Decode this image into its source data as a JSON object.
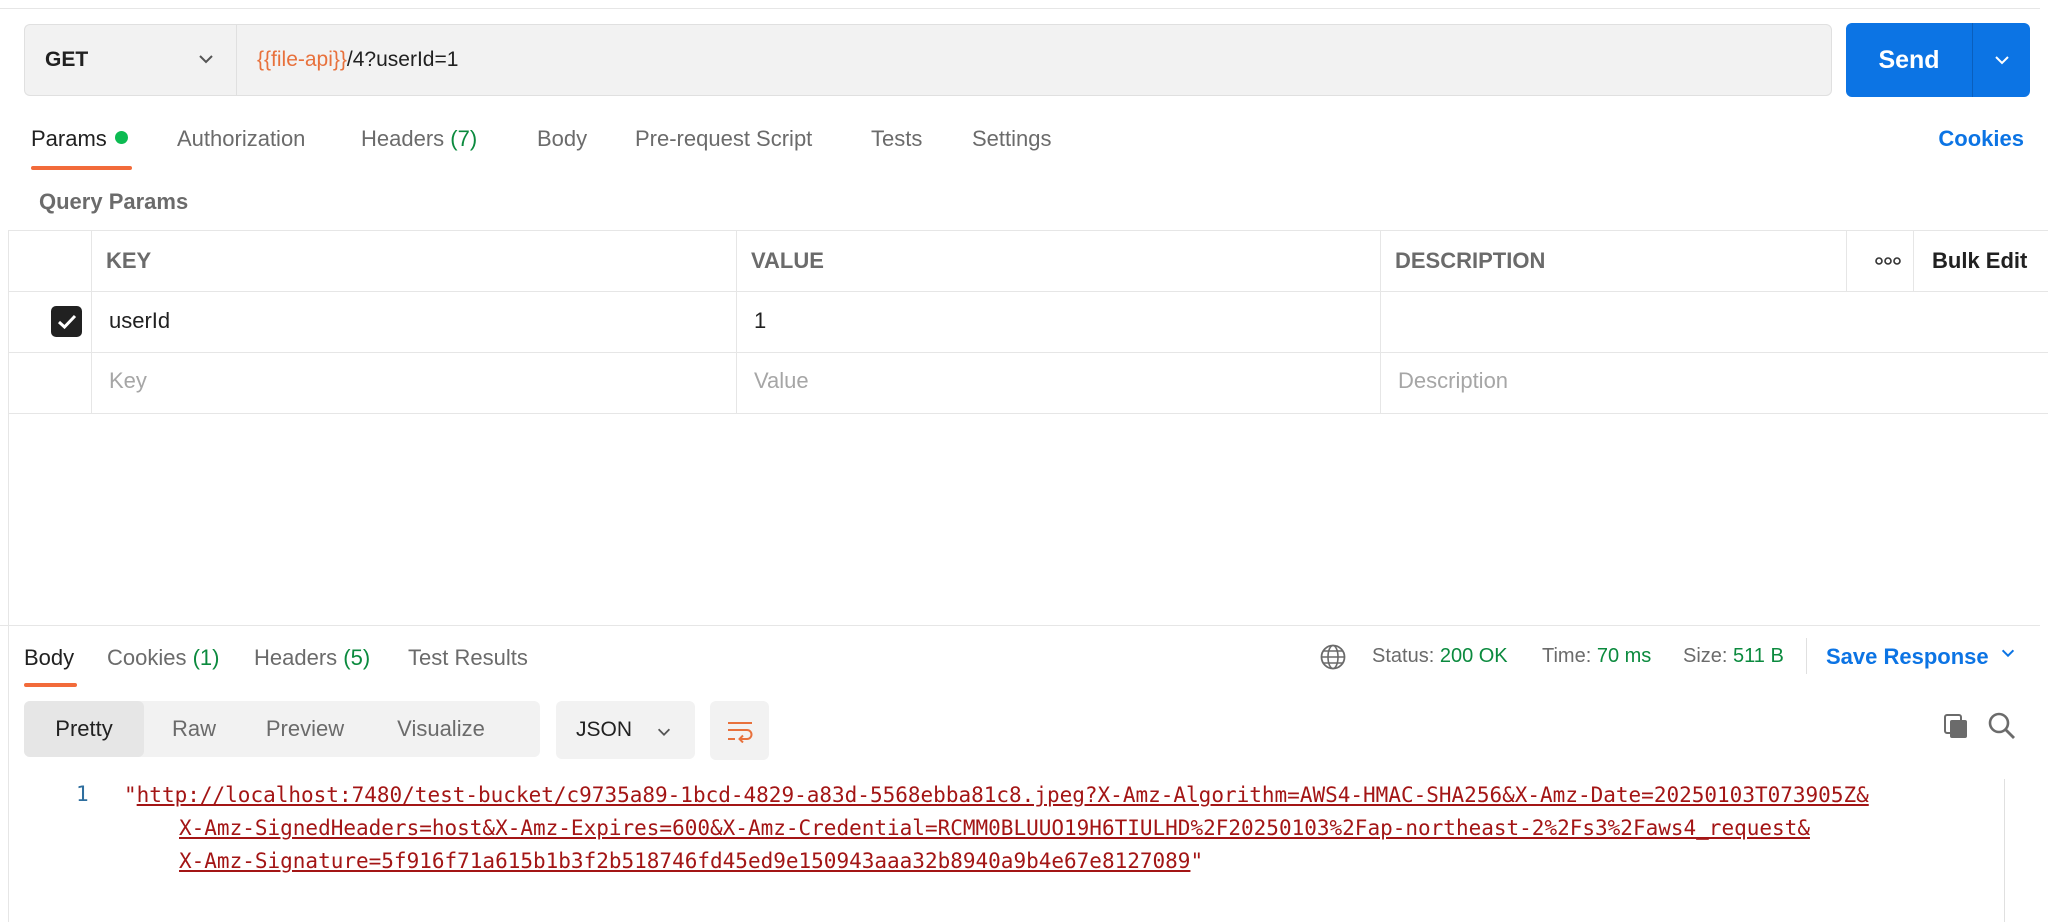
{
  "request": {
    "method": "GET",
    "url_variable": "{{file-api}}",
    "url_rest": "/4?userId=1",
    "send_label": "Send"
  },
  "request_tabs": {
    "params": "Params",
    "authorization": "Authorization",
    "headers": "Headers",
    "headers_count": "(7)",
    "body": "Body",
    "prerequest": "Pre-request Script",
    "tests": "Tests",
    "settings": "Settings",
    "cookies": "Cookies"
  },
  "query_params": {
    "section_label": "Query Params",
    "headers": {
      "key": "KEY",
      "value": "VALUE",
      "description": "DESCRIPTION"
    },
    "bulk_edit": "Bulk Edit",
    "rows": [
      {
        "checked": true,
        "key": "userId",
        "value": "1",
        "description": ""
      }
    ],
    "placeholders": {
      "key": "Key",
      "value": "Value",
      "description": "Description"
    }
  },
  "response_tabs": {
    "body": "Body",
    "cookies": "Cookies",
    "cookies_count": "(1)",
    "headers": "Headers",
    "headers_count": "(5)",
    "test_results": "Test Results"
  },
  "response_meta": {
    "status_label": "Status:",
    "status_value": "200 OK",
    "time_label": "Time:",
    "time_value": "70 ms",
    "size_label": "Size:",
    "size_value": "511 B",
    "save_response": "Save Response"
  },
  "view_modes": {
    "pretty": "Pretty",
    "raw": "Raw",
    "preview": "Preview",
    "visualize": "Visualize"
  },
  "format": "JSON",
  "response_body": {
    "line_number": "1",
    "line1": "http://localhost:7480/test-bucket/c9735a89-1bcd-4829-a83d-5568ebba81c8.jpeg?X-Amz-Algorithm=AWS4-HMAC-SHA256&X-Amz-Date=20250103T073905Z&",
    "line2": "X-Amz-SignedHeaders=host&X-Amz-Expires=600&X-Amz-Credential=RCMM0BLUUO19H6TIULHD%2F20250103%2Fap-northeast-2%2Fs3%2Faws4_request&",
    "line3": "X-Amz-Signature=5f916f71a615b1b3f2b518746fd45ed9e150943aaa32b8940a9b4e67e8127089"
  },
  "icons": {
    "method_dropdown": "chevron-down-icon",
    "send_dropdown": "chevron-down-icon",
    "checkbox": "check-icon",
    "more": "more-horizontal-icon",
    "globe": "globe-icon",
    "wrap": "word-wrap-icon",
    "copy": "copy-icon",
    "search": "search-icon"
  },
  "colors": {
    "accent_blue": "#0c74e4",
    "tab_underline": "#f26b3a",
    "count_green": "#0b8a3e",
    "variable_orange": "#e8713c",
    "string_red": "#a31515"
  }
}
